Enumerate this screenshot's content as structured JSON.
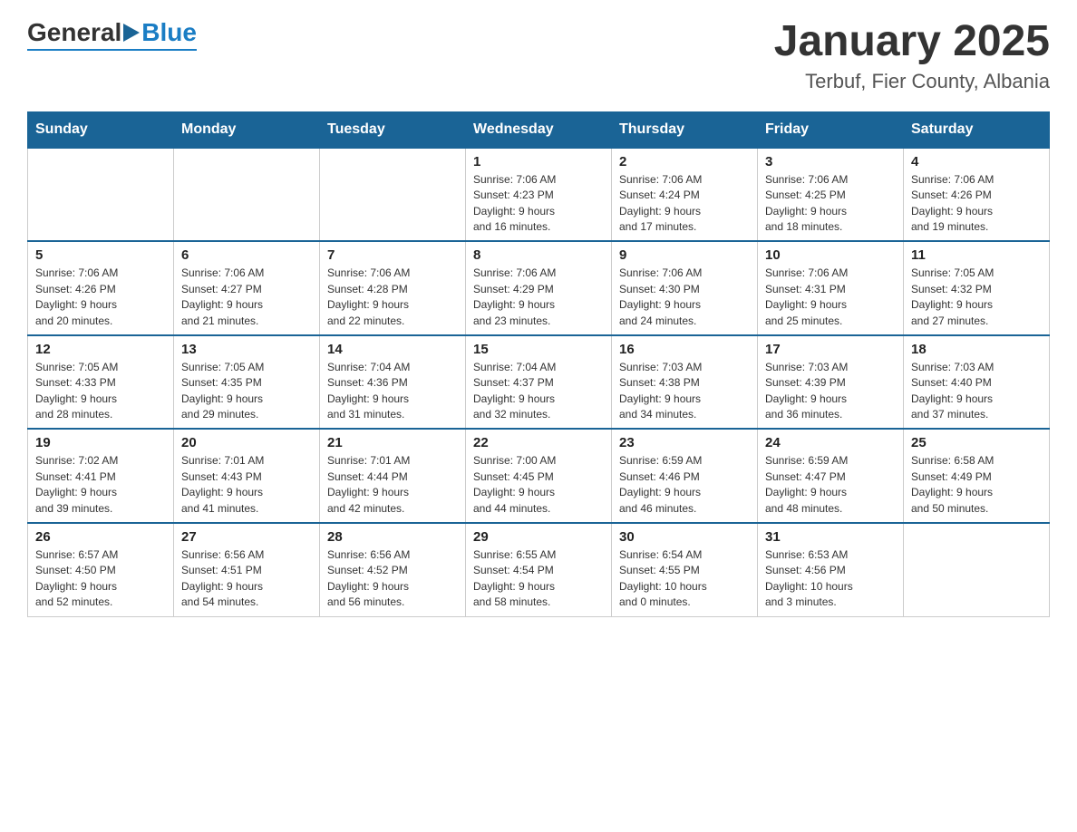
{
  "header": {
    "logo": {
      "general": "General",
      "arrow_color": "#1a6496",
      "blue": "Blue",
      "tagline": "Blue"
    },
    "title": "January 2025",
    "location": "Terbuf, Fier County, Albania"
  },
  "calendar": {
    "days_of_week": [
      "Sunday",
      "Monday",
      "Tuesday",
      "Wednesday",
      "Thursday",
      "Friday",
      "Saturday"
    ],
    "weeks": [
      [
        {
          "day": "",
          "info": ""
        },
        {
          "day": "",
          "info": ""
        },
        {
          "day": "",
          "info": ""
        },
        {
          "day": "1",
          "info": "Sunrise: 7:06 AM\nSunset: 4:23 PM\nDaylight: 9 hours\nand 16 minutes."
        },
        {
          "day": "2",
          "info": "Sunrise: 7:06 AM\nSunset: 4:24 PM\nDaylight: 9 hours\nand 17 minutes."
        },
        {
          "day": "3",
          "info": "Sunrise: 7:06 AM\nSunset: 4:25 PM\nDaylight: 9 hours\nand 18 minutes."
        },
        {
          "day": "4",
          "info": "Sunrise: 7:06 AM\nSunset: 4:26 PM\nDaylight: 9 hours\nand 19 minutes."
        }
      ],
      [
        {
          "day": "5",
          "info": "Sunrise: 7:06 AM\nSunset: 4:26 PM\nDaylight: 9 hours\nand 20 minutes."
        },
        {
          "day": "6",
          "info": "Sunrise: 7:06 AM\nSunset: 4:27 PM\nDaylight: 9 hours\nand 21 minutes."
        },
        {
          "day": "7",
          "info": "Sunrise: 7:06 AM\nSunset: 4:28 PM\nDaylight: 9 hours\nand 22 minutes."
        },
        {
          "day": "8",
          "info": "Sunrise: 7:06 AM\nSunset: 4:29 PM\nDaylight: 9 hours\nand 23 minutes."
        },
        {
          "day": "9",
          "info": "Sunrise: 7:06 AM\nSunset: 4:30 PM\nDaylight: 9 hours\nand 24 minutes."
        },
        {
          "day": "10",
          "info": "Sunrise: 7:06 AM\nSunset: 4:31 PM\nDaylight: 9 hours\nand 25 minutes."
        },
        {
          "day": "11",
          "info": "Sunrise: 7:05 AM\nSunset: 4:32 PM\nDaylight: 9 hours\nand 27 minutes."
        }
      ],
      [
        {
          "day": "12",
          "info": "Sunrise: 7:05 AM\nSunset: 4:33 PM\nDaylight: 9 hours\nand 28 minutes."
        },
        {
          "day": "13",
          "info": "Sunrise: 7:05 AM\nSunset: 4:35 PM\nDaylight: 9 hours\nand 29 minutes."
        },
        {
          "day": "14",
          "info": "Sunrise: 7:04 AM\nSunset: 4:36 PM\nDaylight: 9 hours\nand 31 minutes."
        },
        {
          "day": "15",
          "info": "Sunrise: 7:04 AM\nSunset: 4:37 PM\nDaylight: 9 hours\nand 32 minutes."
        },
        {
          "day": "16",
          "info": "Sunrise: 7:03 AM\nSunset: 4:38 PM\nDaylight: 9 hours\nand 34 minutes."
        },
        {
          "day": "17",
          "info": "Sunrise: 7:03 AM\nSunset: 4:39 PM\nDaylight: 9 hours\nand 36 minutes."
        },
        {
          "day": "18",
          "info": "Sunrise: 7:03 AM\nSunset: 4:40 PM\nDaylight: 9 hours\nand 37 minutes."
        }
      ],
      [
        {
          "day": "19",
          "info": "Sunrise: 7:02 AM\nSunset: 4:41 PM\nDaylight: 9 hours\nand 39 minutes."
        },
        {
          "day": "20",
          "info": "Sunrise: 7:01 AM\nSunset: 4:43 PM\nDaylight: 9 hours\nand 41 minutes."
        },
        {
          "day": "21",
          "info": "Sunrise: 7:01 AM\nSunset: 4:44 PM\nDaylight: 9 hours\nand 42 minutes."
        },
        {
          "day": "22",
          "info": "Sunrise: 7:00 AM\nSunset: 4:45 PM\nDaylight: 9 hours\nand 44 minutes."
        },
        {
          "day": "23",
          "info": "Sunrise: 6:59 AM\nSunset: 4:46 PM\nDaylight: 9 hours\nand 46 minutes."
        },
        {
          "day": "24",
          "info": "Sunrise: 6:59 AM\nSunset: 4:47 PM\nDaylight: 9 hours\nand 48 minutes."
        },
        {
          "day": "25",
          "info": "Sunrise: 6:58 AM\nSunset: 4:49 PM\nDaylight: 9 hours\nand 50 minutes."
        }
      ],
      [
        {
          "day": "26",
          "info": "Sunrise: 6:57 AM\nSunset: 4:50 PM\nDaylight: 9 hours\nand 52 minutes."
        },
        {
          "day": "27",
          "info": "Sunrise: 6:56 AM\nSunset: 4:51 PM\nDaylight: 9 hours\nand 54 minutes."
        },
        {
          "day": "28",
          "info": "Sunrise: 6:56 AM\nSunset: 4:52 PM\nDaylight: 9 hours\nand 56 minutes."
        },
        {
          "day": "29",
          "info": "Sunrise: 6:55 AM\nSunset: 4:54 PM\nDaylight: 9 hours\nand 58 minutes."
        },
        {
          "day": "30",
          "info": "Sunrise: 6:54 AM\nSunset: 4:55 PM\nDaylight: 10 hours\nand 0 minutes."
        },
        {
          "day": "31",
          "info": "Sunrise: 6:53 AM\nSunset: 4:56 PM\nDaylight: 10 hours\nand 3 minutes."
        },
        {
          "day": "",
          "info": ""
        }
      ]
    ]
  }
}
